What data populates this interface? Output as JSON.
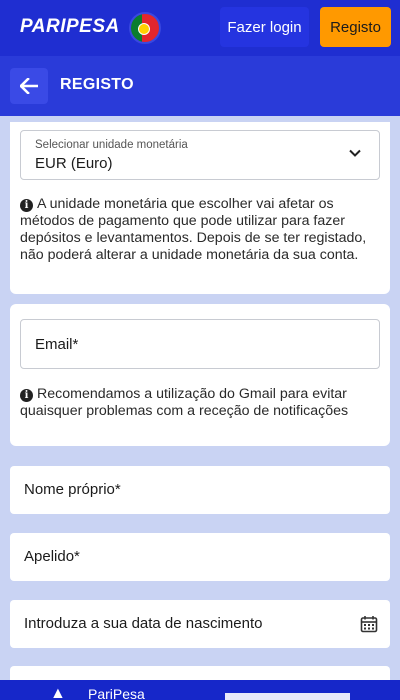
{
  "header": {
    "logo_text": "PARIPESA",
    "login_label": "Fazer login",
    "register_label": "Registo",
    "flag_icon": "portugal-flag-icon"
  },
  "titlebar": {
    "title": "REGISTO",
    "back_icon": "arrow-left-icon"
  },
  "currency": {
    "label": "Selecionar unidade monetária",
    "value": "EUR  (Euro)",
    "note": "A unidade monetária que escolher vai afetar os métodos de pagamento que pode utilizar para fazer depósitos e levantamentos. Depois de se ter registado, não poderá alterar a unidade monetária da sua conta."
  },
  "email": {
    "placeholder": "Email*",
    "note": "Recomendamos a utilização do Gmail para evitar quaisquer problemas com a receção de notificações"
  },
  "fields": {
    "first_name_placeholder": "Nome próprio*",
    "last_name_placeholder": "Apelido*",
    "dob_placeholder": "Introduza a sua data de nascimento"
  },
  "bottom": {
    "label": "PariPesa"
  },
  "colors": {
    "brand_blue": "#1f2ed1",
    "accent_orange": "#ff9900",
    "background": "#c9d3f3"
  }
}
